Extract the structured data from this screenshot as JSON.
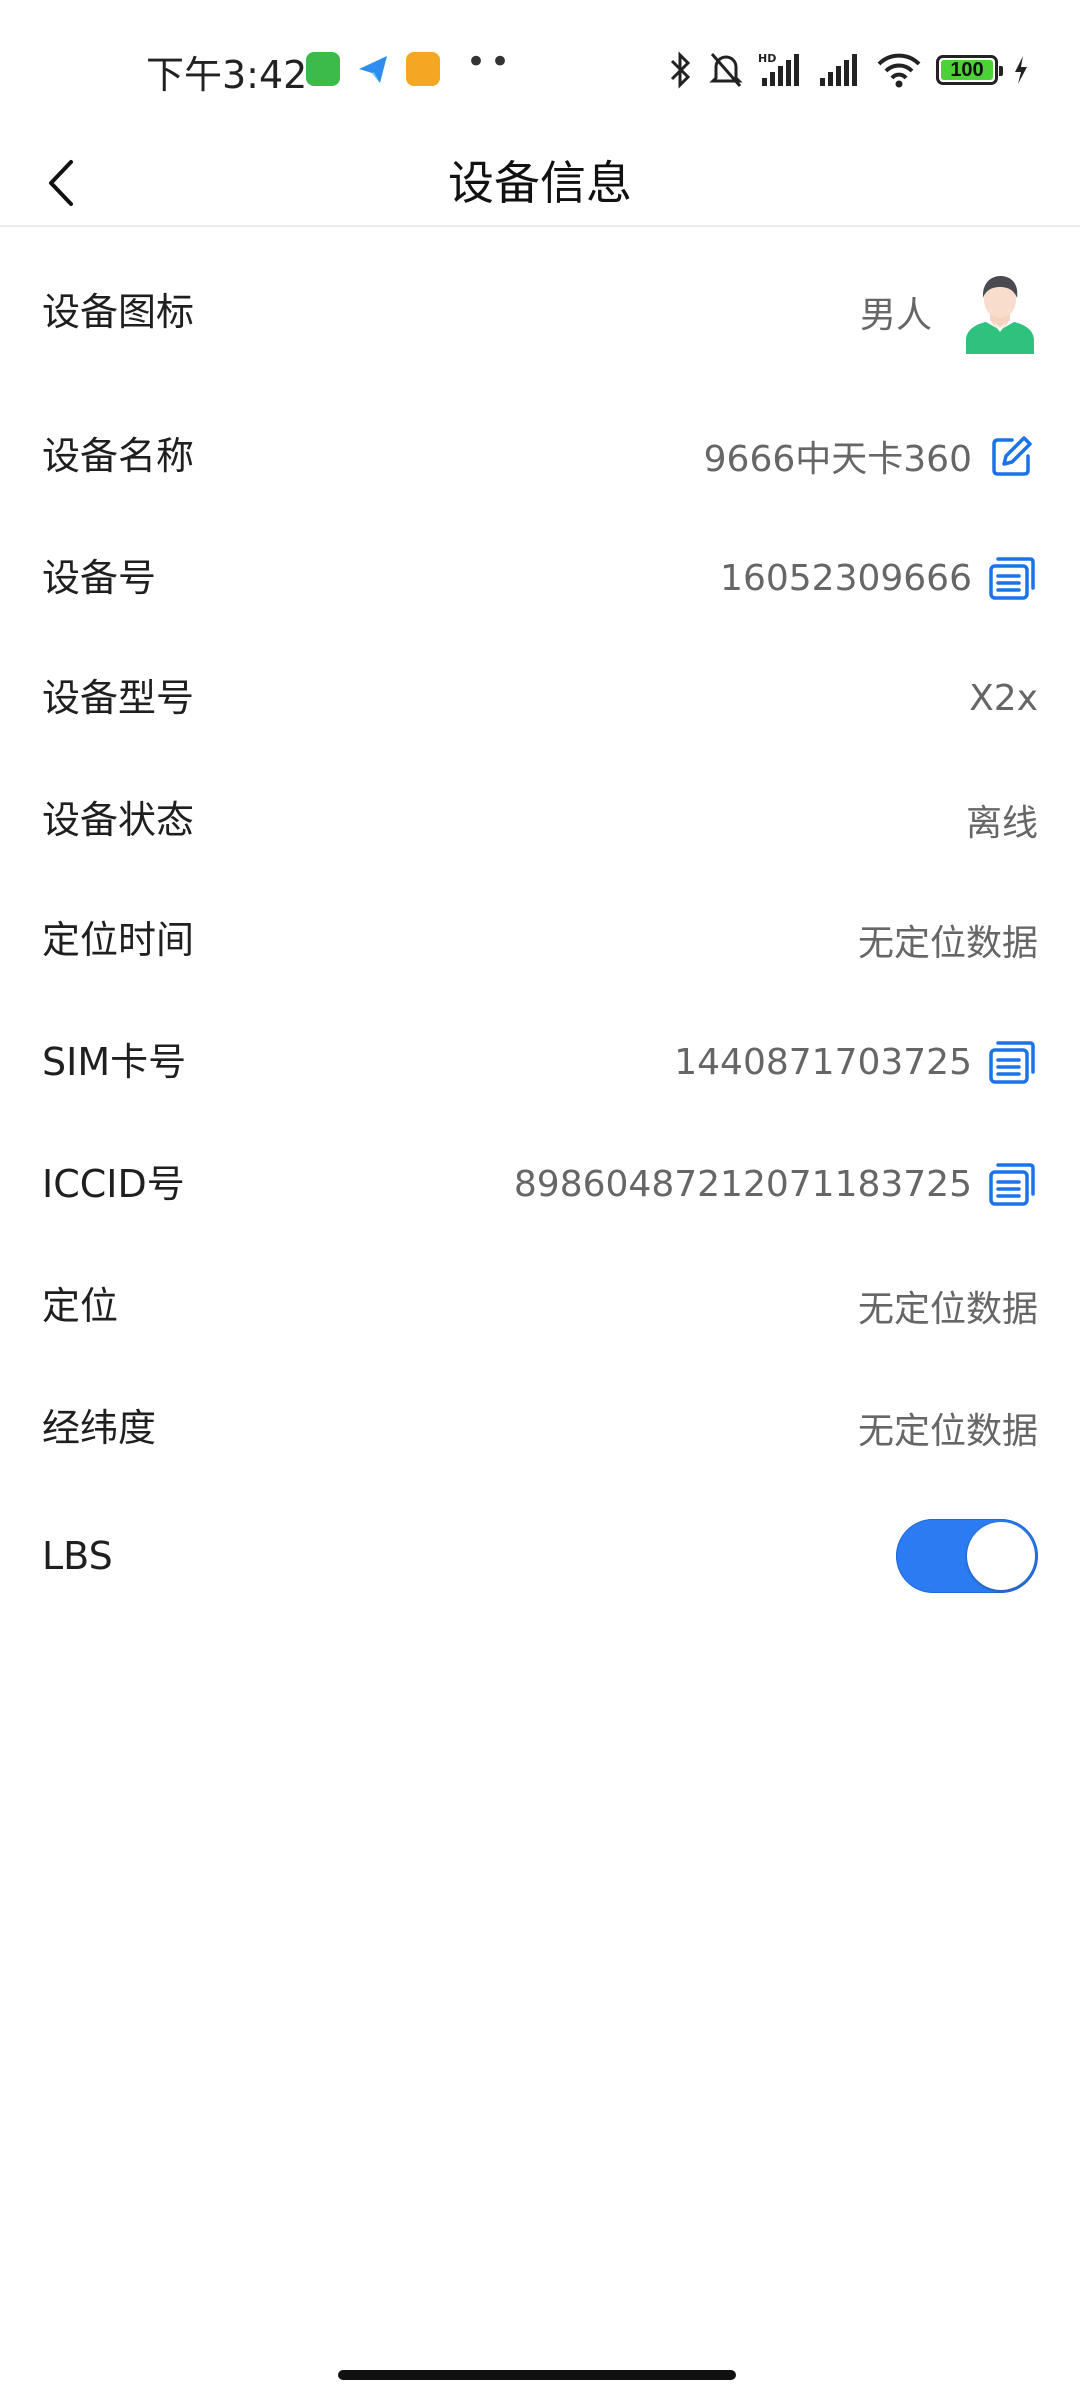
{
  "status_bar": {
    "time": "下午3:42",
    "more_dots": "••",
    "battery": "100"
  },
  "header": {
    "title": "设备信息"
  },
  "rows": {
    "icon": {
      "label": "设备图标",
      "value": "男人"
    },
    "name": {
      "label": "设备名称",
      "value": "9666中天卡360"
    },
    "number": {
      "label": "设备号",
      "value": "16052309666"
    },
    "model": {
      "label": "设备型号",
      "value": "X2x"
    },
    "state": {
      "label": "设备状态",
      "value": "离线"
    },
    "loc_time": {
      "label": "定位时间",
      "value": "无定位数据"
    },
    "sim": {
      "label": "SIM卡号",
      "value": "1440871703725"
    },
    "iccid": {
      "label": "ICCID号",
      "value": "89860487212071183725"
    },
    "location": {
      "label": "定位",
      "value": "无定位数据"
    },
    "latlng": {
      "label": "经纬度",
      "value": "无定位数据"
    },
    "lbs": {
      "label": "LBS",
      "enabled": true
    }
  },
  "colors": {
    "accent": "#2b7cf3",
    "icon_blue": "#1a73e8",
    "avatar_shirt": "#2ec27e"
  }
}
